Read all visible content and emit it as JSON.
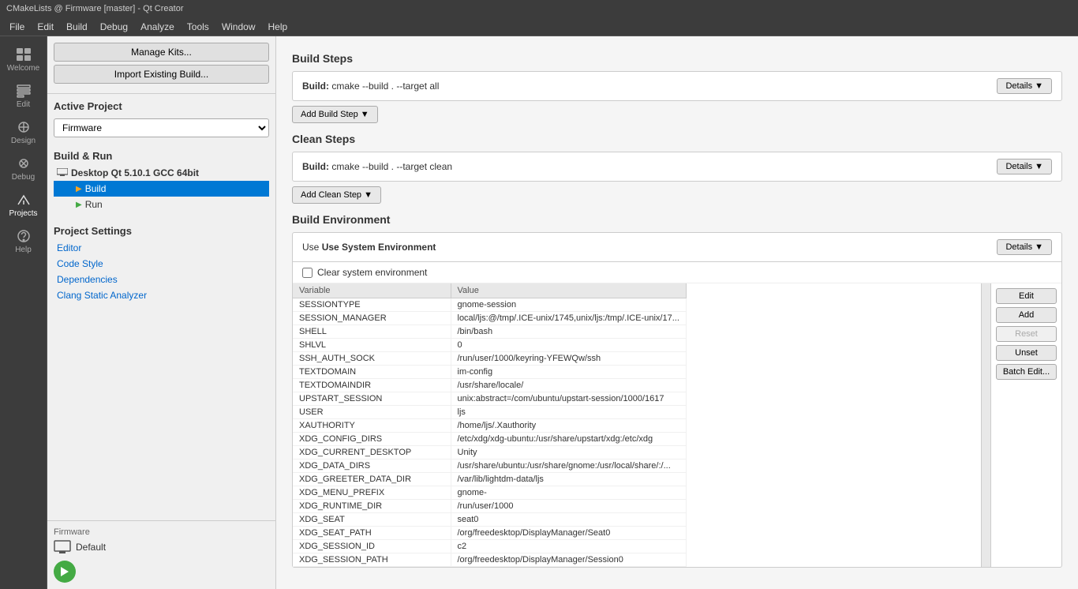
{
  "titleBar": {
    "text": "CMakeLists @ Firmware [master] - Qt Creator"
  },
  "menuBar": {
    "items": [
      "File",
      "Edit",
      "Build",
      "Debug",
      "Analyze",
      "Tools",
      "Window",
      "Help"
    ]
  },
  "iconBar": {
    "items": [
      {
        "name": "welcome",
        "label": "Welcome",
        "icon": "grid"
      },
      {
        "name": "edit",
        "label": "Edit",
        "icon": "edit"
      },
      {
        "name": "design",
        "label": "Design",
        "icon": "design"
      },
      {
        "name": "debug",
        "label": "Debug",
        "icon": "bug"
      },
      {
        "name": "projects",
        "label": "Projects",
        "icon": "wrench"
      },
      {
        "name": "help",
        "label": "Help",
        "icon": "help"
      }
    ]
  },
  "leftPanel": {
    "manageKitsBtn": "Manage Kits...",
    "importBuildBtn": "Import Existing Build...",
    "activeProjectSection": "Active Project",
    "projectName": "Firmware",
    "buildRunSection": "Build & Run",
    "desktopKit": "Desktop Qt 5.10.1 GCC 64bit",
    "buildItem": "Build",
    "runItem": "Run",
    "projectSettingsSection": "Project Settings",
    "settingsLinks": [
      "Editor",
      "Code Style",
      "Dependencies",
      "Clang Static Analyzer"
    ],
    "bottomDevice": "Firmware",
    "bottomDeviceType": "Default"
  },
  "mainContent": {
    "buildStepsHeader": "Build Steps",
    "buildStepCmd": "cmake --build . --target all",
    "buildStepLabel": "Build:",
    "detailsLabel1": "Details",
    "addBuildStepBtn": "Add Build Step",
    "cleanStepsHeader": "Clean Steps",
    "cleanStepCmd": "cmake --build . --target clean",
    "cleanStepLabel": "Build:",
    "detailsLabel2": "Details",
    "addCleanStepBtn": "Add Clean Step",
    "buildEnvHeader": "Build Environment",
    "useSystemEnvLabel": "Use System Environment",
    "detailsLabel3": "Details",
    "clearSystemEnvLabel": "Clear system environment",
    "envTableHeaders": [
      "Variable",
      "Value"
    ],
    "envRows": [
      {
        "var": "SESSIONTYPE",
        "val": "gnome-session"
      },
      {
        "var": "SESSION_MANAGER",
        "val": "local/ljs:@/tmp/.ICE-unix/1745,unix/ljs:/tmp/.ICE-unix/17..."
      },
      {
        "var": "SHELL",
        "val": "/bin/bash"
      },
      {
        "var": "SHLVL",
        "val": "0"
      },
      {
        "var": "SSH_AUTH_SOCK",
        "val": "/run/user/1000/keyring-YFEWQw/ssh"
      },
      {
        "var": "TEXTDOMAIN",
        "val": "im-config"
      },
      {
        "var": "TEXTDOMAINDIR",
        "val": "/usr/share/locale/"
      },
      {
        "var": "UPSTART_SESSION",
        "val": "unix:abstract=/com/ubuntu/upstart-session/1000/1617"
      },
      {
        "var": "USER",
        "val": "ljs"
      },
      {
        "var": "XAUTHORITY",
        "val": "/home/ljs/.Xauthority"
      },
      {
        "var": "XDG_CONFIG_DIRS",
        "val": "/etc/xdg/xdg-ubuntu:/usr/share/upstart/xdg:/etc/xdg"
      },
      {
        "var": "XDG_CURRENT_DESKTOP",
        "val": "Unity"
      },
      {
        "var": "XDG_DATA_DIRS",
        "val": "/usr/share/ubuntu:/usr/share/gnome:/usr/local/share/:/..."
      },
      {
        "var": "XDG_GREETER_DATA_DIR",
        "val": "/var/lib/lightdm-data/ljs"
      },
      {
        "var": "XDG_MENU_PREFIX",
        "val": "gnome-"
      },
      {
        "var": "XDG_RUNTIME_DIR",
        "val": "/run/user/1000"
      },
      {
        "var": "XDG_SEAT",
        "val": "seat0"
      },
      {
        "var": "XDG_SEAT_PATH",
        "val": "/org/freedesktop/DisplayManager/Seat0"
      },
      {
        "var": "XDG_SESSION_ID",
        "val": "c2"
      },
      {
        "var": "XDG_SESSION_PATH",
        "val": "/org/freedesktop/DisplayManager/Session0"
      }
    ],
    "envButtons": {
      "edit": "Edit",
      "add": "Add",
      "reset": "Reset",
      "unset": "Unset",
      "batchEdit": "Batch Edit..."
    }
  }
}
